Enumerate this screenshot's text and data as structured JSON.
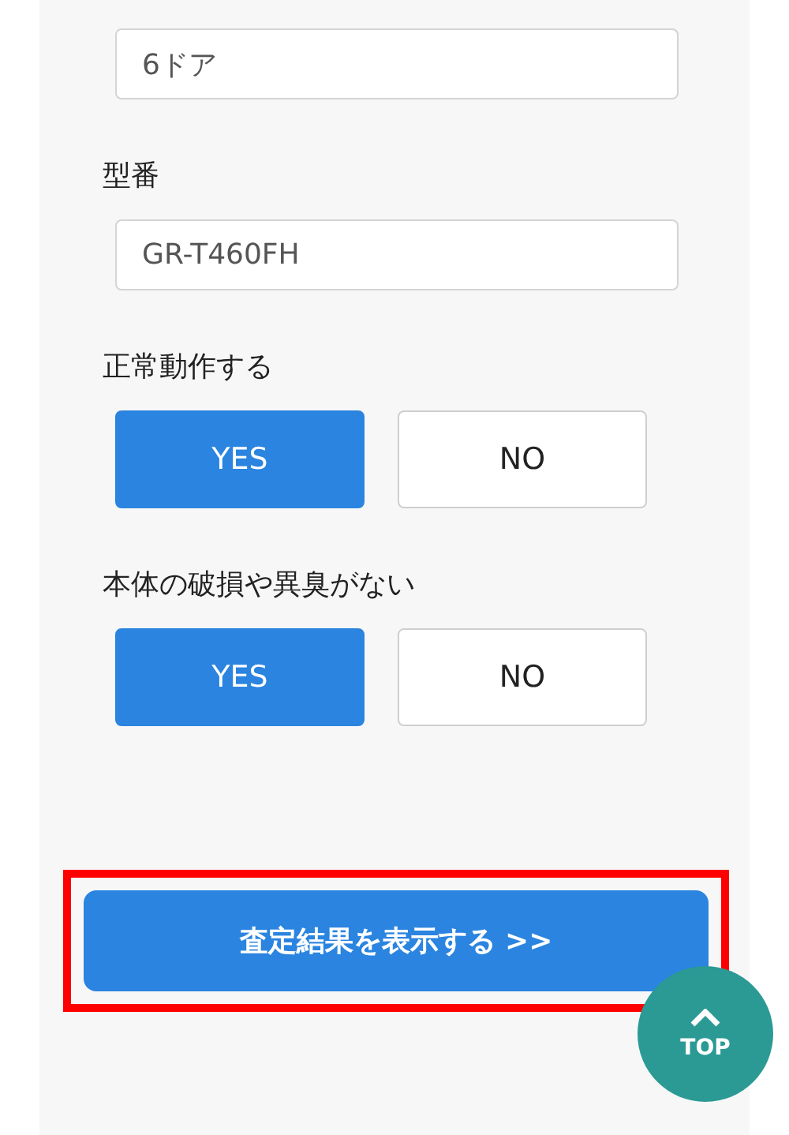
{
  "top_field": {
    "value": "6ドア"
  },
  "model": {
    "label": "型番",
    "value": "GR-T460FH"
  },
  "questions": [
    {
      "label": "正常動作する",
      "options": [
        {
          "text": "YES",
          "selected": true
        },
        {
          "text": "NO",
          "selected": false
        }
      ]
    },
    {
      "label": "本体の破損や異臭がない",
      "options": [
        {
          "text": "YES",
          "selected": true
        },
        {
          "text": "NO",
          "selected": false
        }
      ]
    }
  ],
  "submit": {
    "text": "査定結果を表示する >>",
    "highlighted": true
  },
  "top_button": {
    "text": "TOP"
  }
}
